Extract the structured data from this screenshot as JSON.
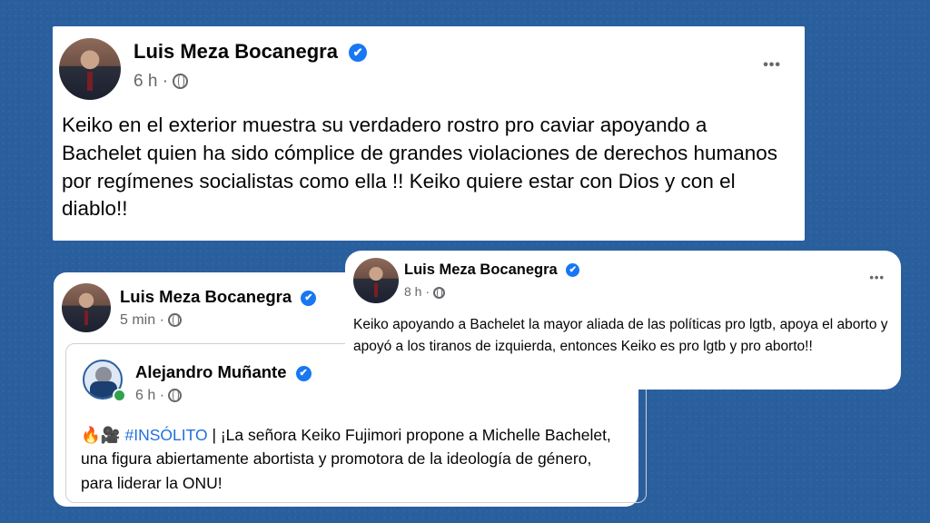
{
  "post1": {
    "author": "Luis Meza Bocanegra",
    "time": "6 h",
    "dot": "·",
    "text": "Keiko en el exterior muestra su verdadero rostro pro caviar apoyando a Bachelet quien ha sido cómplice de grandes violaciones de derechos humanos por regímenes socialistas como ella !! Keiko quiere estar con Dios y con el diablo!!"
  },
  "post2": {
    "author": "Luis Meza Bocanegra",
    "time": "8 h",
    "dot": "·",
    "text": "Keiko apoyando a Bachelet la mayor aliada de las políticas pro lgtb, apoya el aborto y apoyó a los tiranos de izquierda, entonces Keiko es pro lgtb y pro aborto!!"
  },
  "post3": {
    "author": "Luis Meza Bocanegra",
    "time": "5 min",
    "dot": "·",
    "shared": {
      "author": "Alejandro Muñante",
      "time": "6 h",
      "dot": "·",
      "emojis": "🔥🎥",
      "hashtag": "#INSÓLITO",
      "text": " | ¡La señora Keiko Fujimori propone a Michelle Bachelet, una figura abiertamente abortista y promotora de la ideología de género, para liderar la ONU!"
    }
  },
  "icons": {
    "verified": "✔",
    "more": "•••",
    "globe": "globe-icon"
  },
  "colors": {
    "background": "#2a5f9e",
    "verified": "#1877f2",
    "hashtag": "#216fdb",
    "meta": "#65676b",
    "online": "#31a24c"
  }
}
